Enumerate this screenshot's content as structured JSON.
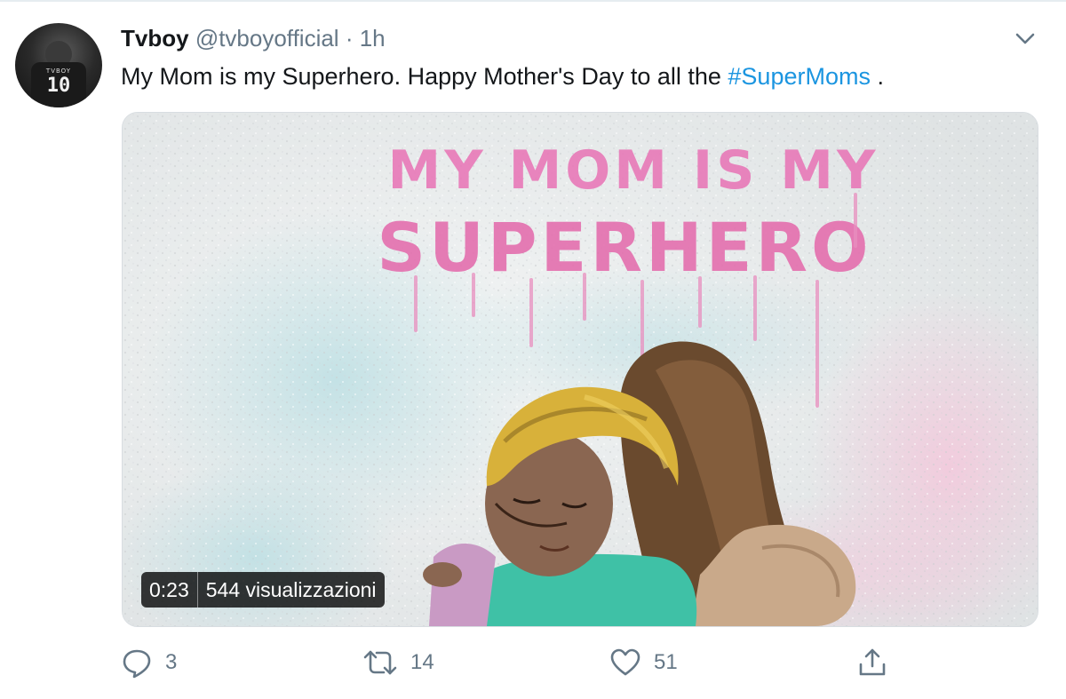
{
  "tweet": {
    "author_name": "Tvboy",
    "author_handle": "@tvboyofficial",
    "separator": "·",
    "time": "1h",
    "text_before": "My Mom is my Superhero. Happy Mother's Day to all the ",
    "hashtag": "#SuperMoms",
    "text_after": " ."
  },
  "avatar": {
    "shirt_text": "TVBOY",
    "shirt_number": "10"
  },
  "media": {
    "mural_line1": "MY MOM IS MY",
    "mural_line2": "SUPERHERO",
    "duration": "0:23",
    "views": "544 visualizzazioni"
  },
  "actions": {
    "reply_count": "3",
    "retweet_count": "14",
    "like_count": "51"
  },
  "icons": {
    "menu": "chevron-down-icon",
    "reply": "reply-icon",
    "retweet": "retweet-icon",
    "like": "like-icon",
    "share": "share-icon"
  },
  "colors": {
    "hashtag": "#1b95e0",
    "secondary_text": "#657786",
    "mural_text": "#e879b8"
  }
}
